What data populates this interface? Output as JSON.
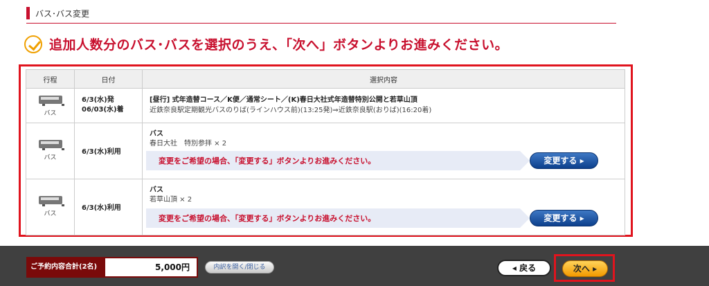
{
  "section": {
    "title": "バス･バス変更"
  },
  "headline": {
    "text": "追加人数分のバス･バスを選択のうえ、「次へ」ボタンよりお進みください。"
  },
  "table": {
    "headers": [
      "行程",
      "日付",
      "選択内容"
    ],
    "rows": [
      {
        "type": "バス",
        "date_line1": "6/3(水)発",
        "date_line2": "06/03(水)着",
        "title": "[昼行] 式年造替コース／K便／通常シート／(K)春日大社式年造替特別公開と若草山頂",
        "sub": "近鉄奈良駅定期観光バスのりば(ラインハウス前)(13:25発)⇒近鉄奈良駅(おりば)(16:20着)"
      },
      {
        "type": "バス",
        "date_line1": "6/3(水)利用",
        "title": "バス",
        "sub": "春日大社　特別参拝 × 2",
        "notice": "変更をご希望の場合、「変更する」ボタンよりお進みください。",
        "button": "変更する ▸"
      },
      {
        "type": "バス",
        "date_line1": "6/3(水)利用",
        "title": "バス",
        "sub": "若草山頂 × 2",
        "notice": "変更をご希望の場合、「変更する」ボタンよりお進みください。",
        "button": "変更する ▸"
      }
    ]
  },
  "footer": {
    "total_label": "ご予約内容合計(2名)",
    "total_value": "5,000円",
    "detail_button": "内訳を開く/閉じる",
    "back_button": "◂ 戻る",
    "next_button": "次へ ▸"
  },
  "colors": {
    "accent_red": "#c8102e",
    "button_blue": "#0c3f8c",
    "next_orange": "#f39a00",
    "footer_bg": "#404040"
  }
}
